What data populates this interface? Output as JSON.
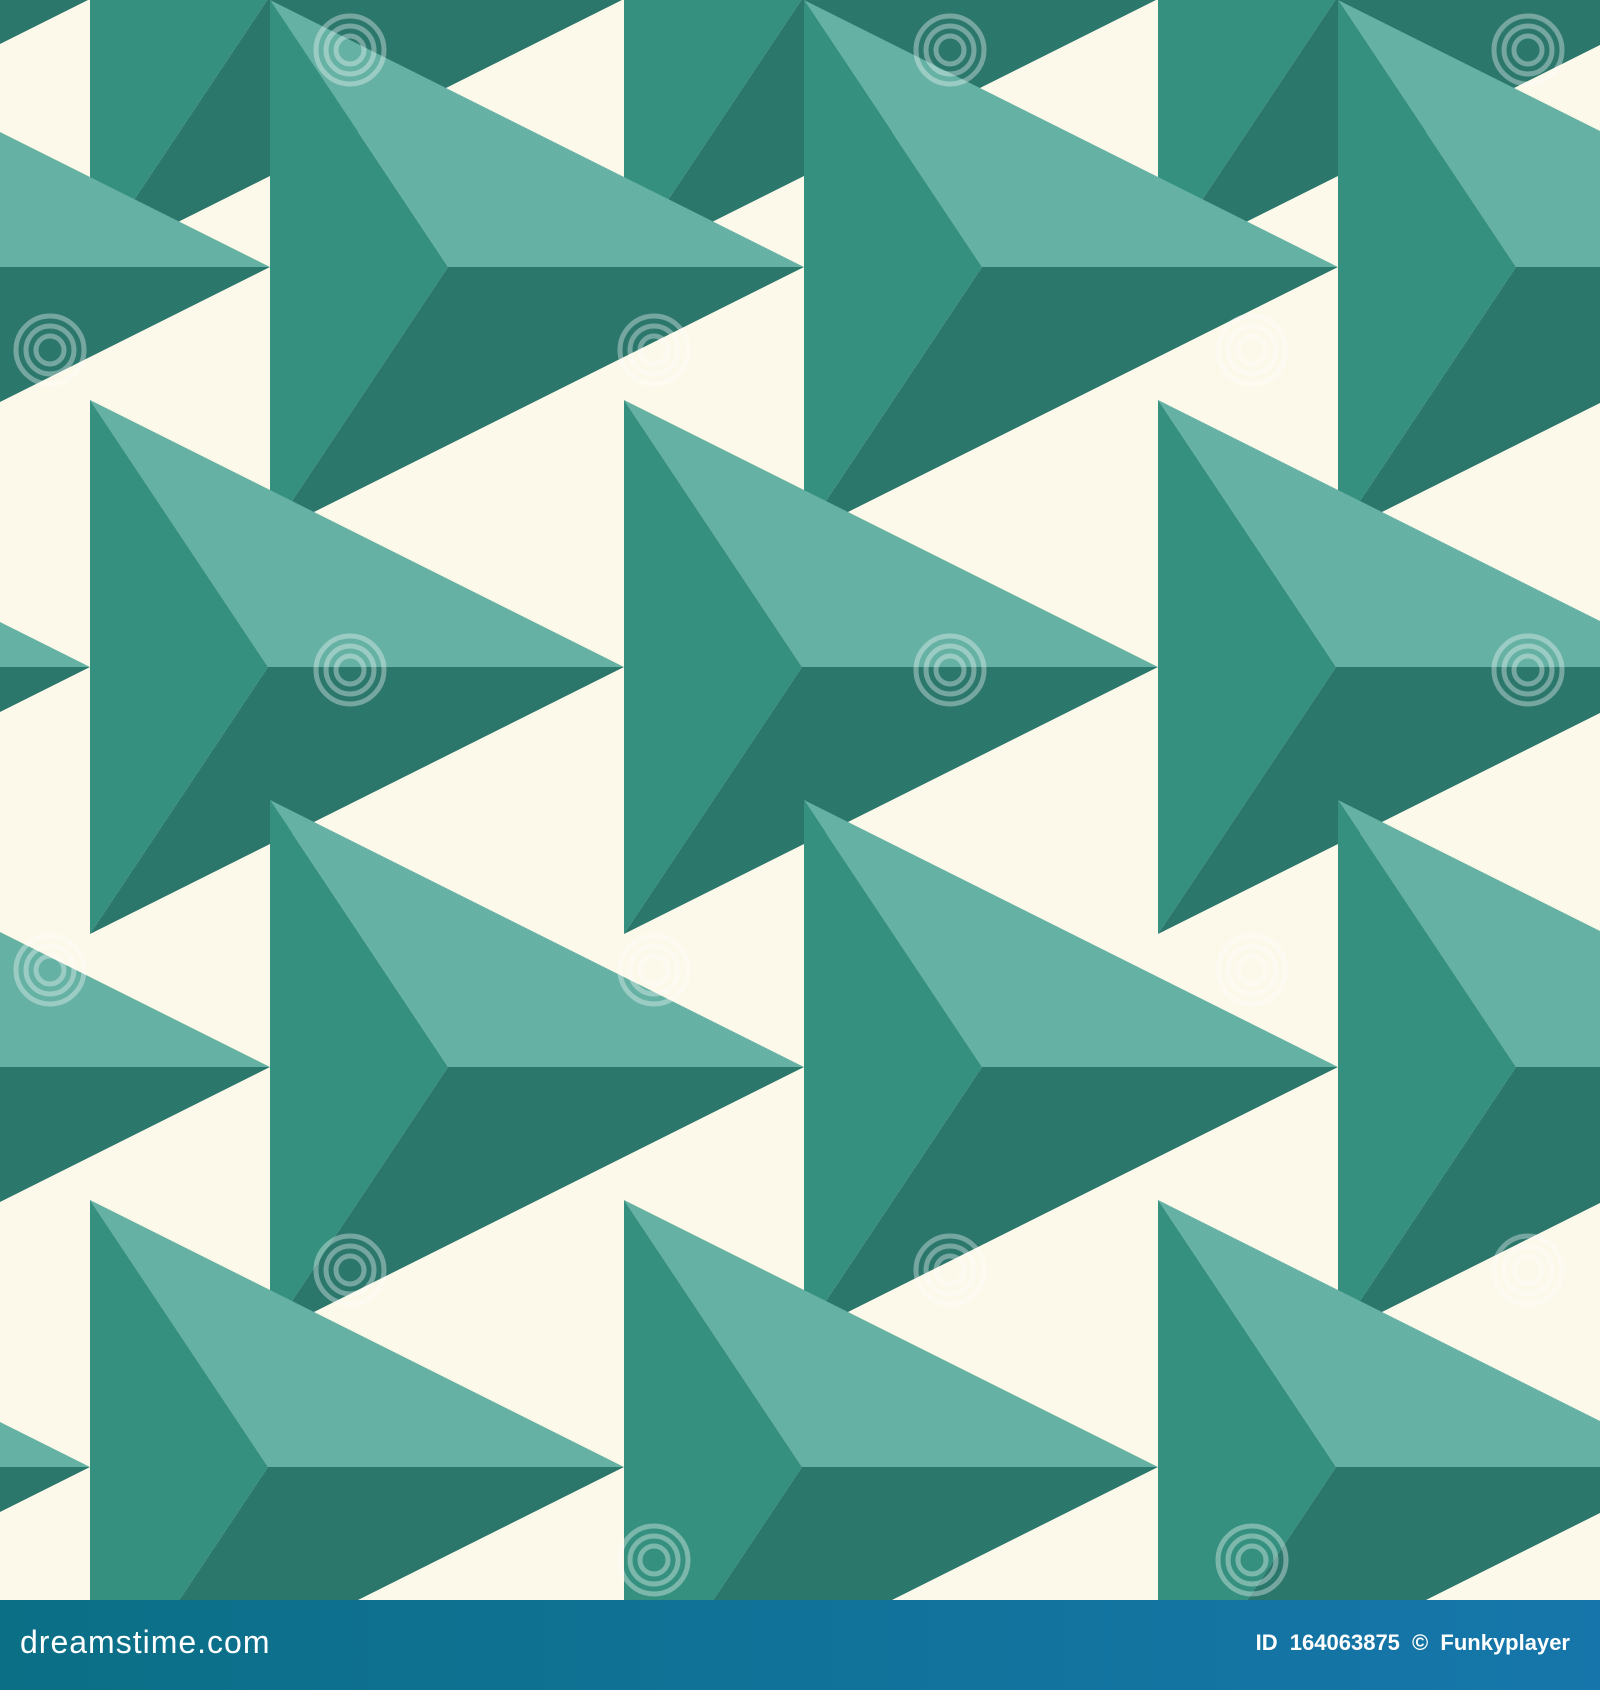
{
  "colors": {
    "background": "#fdf9ea",
    "facet_light": "#65b1a3",
    "facet_mid": "#35907f",
    "facet_dark": "#2b776c",
    "footer_start": "#0b6f86",
    "footer_end": "#1676ab",
    "footer_text": "#ffffff"
  },
  "pattern": {
    "description_name": "repeating 3D triangular pyramid arrows pointing right",
    "watermark_text": "dreamstime",
    "watermark_icon": "spiral-icon"
  },
  "footer": {
    "brand": "dreamstime.com",
    "id_label": "ID",
    "id_value": "164063875",
    "copyright_symbol": "©",
    "author": "Funkyplayer"
  }
}
